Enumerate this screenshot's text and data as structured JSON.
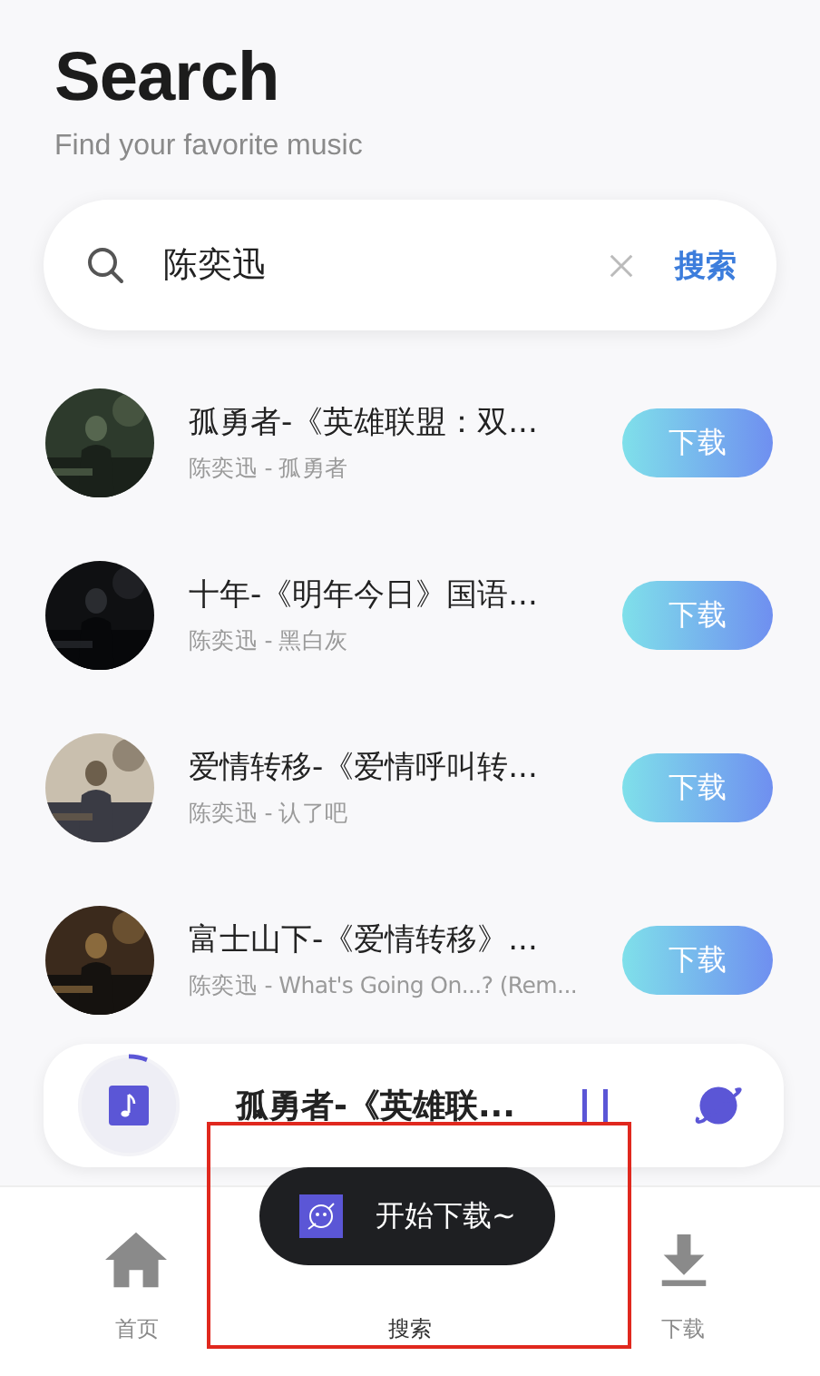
{
  "header": {
    "title": "Search",
    "subtitle": "Find your favorite music"
  },
  "search": {
    "value": "陈奕迅",
    "action": "搜索"
  },
  "results": [
    {
      "title": "孤勇者-《英雄联盟：双...",
      "subtitle": "陈奕迅 - 孤勇者",
      "button": "下载"
    },
    {
      "title": "十年-《明年今日》国语...",
      "subtitle": "陈奕迅 - 黑白灰",
      "button": "下载"
    },
    {
      "title": "爱情转移-《爱情呼叫转...",
      "subtitle": "陈奕迅 - 认了吧",
      "button": "下载"
    },
    {
      "title": "富士山下-《爱情转移》...",
      "subtitle": "陈奕迅 - What's Going On...? (Rem...",
      "button": "下载"
    }
  ],
  "player": {
    "title": "孤勇者-《英雄联...",
    "level": 0.06,
    "playing": true
  },
  "nav": [
    {
      "label": "首页",
      "kind": "home",
      "selected": false
    },
    {
      "label": "搜索",
      "kind": "search",
      "selected": true
    },
    {
      "label": "下载",
      "kind": "download",
      "selected": false
    }
  ],
  "toast": {
    "text": "开始下载~"
  }
}
